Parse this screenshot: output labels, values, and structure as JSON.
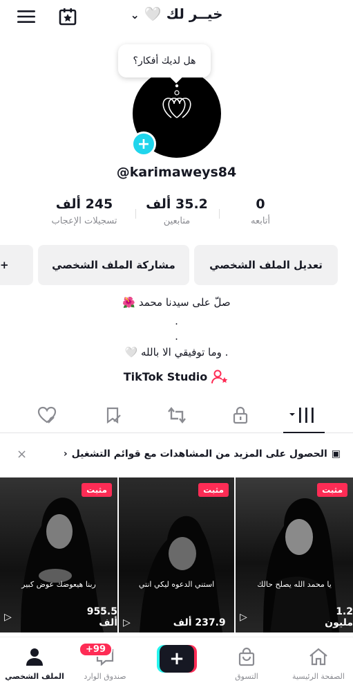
{
  "header": {
    "title": "خيــر لك 🤍",
    "menu_icon": "hamburger-icon",
    "calendar_icon": "calendar-star-icon"
  },
  "profile": {
    "thought_bubble": "هل لديك أفكار؟",
    "username": "@karimaweys84",
    "stats": {
      "following": {
        "value": "0",
        "label": "أتابعه"
      },
      "followers": {
        "value": "35.2 ألف",
        "label": "متابعين"
      },
      "likes": {
        "value": "245 ألف",
        "label": "تسجيلات الإعجاب"
      }
    },
    "buttons": {
      "edit": "تعديل الملف الشخصي",
      "share": "مشاركة الملف الشخصي",
      "add_friend": "+"
    },
    "bio": {
      "line1": "صلّ على سيدنا محمد 🌺",
      "line2": ".",
      "line3": ".",
      "line4": ". وما توفيقي الا بالله 🤍"
    },
    "studio_link": "TikTok Studio"
  },
  "banner": {
    "text": "الحصول على المزيد من المشاهدات مع قوائم التشغيل",
    "close": "×"
  },
  "videos": [
    {
      "pinned_label": "مثبت",
      "caption": "يا محمد الله يصلح حالك",
      "views": "1.2 مليون"
    },
    {
      "pinned_label": "مثبت",
      "caption": "استني الدعوه ليكي انتي",
      "views": "237.9 ألف"
    },
    {
      "pinned_label": "مثبت",
      "caption": "ربنا هيعوضك عوض كبير",
      "views": "955.5 ألف"
    }
  ],
  "nav": {
    "home": "الصفحة الرئيسية",
    "shop": "التسوق",
    "create": "+",
    "inbox": "صندوق الوارد",
    "inbox_badge": "+99",
    "profile": "الملف الشخصي"
  },
  "colors": {
    "accent_red": "#fe2c55",
    "accent_cyan": "#25f4ee",
    "plus_badge": "#20d5ec"
  }
}
